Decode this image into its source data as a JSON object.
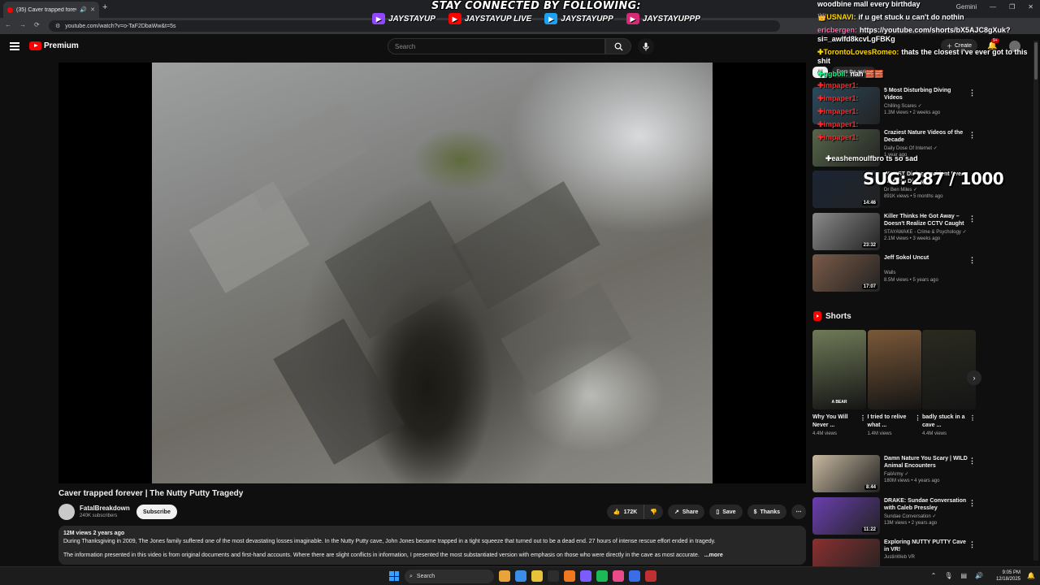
{
  "browser": {
    "tab_title": "(35) Caver trapped forever",
    "url": "youtube.com/watch?v=o-TaF2DbaWw&t=5s",
    "gemini_label": "Gemini"
  },
  "overlay": {
    "banner": "STAY CONNECTED BY FOLLOWING:",
    "socials": [
      {
        "platform_icon": "twitch-icon",
        "handle": "JAYSTAYUP",
        "color": "#9146ff"
      },
      {
        "platform_icon": "youtube-icon",
        "handle": "JAYSTAYUP LIVE",
        "color": "#ff0000"
      },
      {
        "platform_icon": "twitter-icon",
        "handle": "JAYSTAYUPP",
        "color": "#1da1f2"
      },
      {
        "platform_icon": "instagram-icon",
        "handle": "JAYSTAYUPPP",
        "color": "#d62976"
      }
    ],
    "chat": [
      {
        "user": "",
        "text": "woodbine mall every birthday",
        "color": "#ffffff"
      },
      {
        "user": "👑USNAVI:",
        "text": "if u get stuck u can't do nothin",
        "color": "#ffd700"
      },
      {
        "user": "ericbergen:",
        "text": "https://youtube.com/shorts/bX5AJC8gXuk?si=_awlfd8kcvLgFBKg",
        "color": "#ff69b4"
      },
      {
        "user": "✚TorontoLovesRomeo:",
        "text": "thats the closest i've ever got to this shit",
        "color": "#ffd700"
      },
      {
        "user": "✚ggboii:",
        "text": "nah 🧱🧱",
        "color": "#00ff7f"
      }
    ],
    "impaper_lines": [
      "✚impaper1:",
      "✚impaper1:",
      "✚impaper1:",
      "✚impaper1:",
      "✚impaper1:"
    ],
    "chat_extra": "✚eashemoulfbro ts so sad",
    "sub_goal": "SUG: 287 / 1000"
  },
  "header": {
    "logo_text": "Premium",
    "search_placeholder": "Search",
    "create_label": "Create",
    "notif_count": "9+"
  },
  "video": {
    "title": "Caver trapped forever | The Nutty Putty Tragedy",
    "channel": "FatalBreakdown",
    "subscribers": "240K subscribers",
    "subscribe_label": "Subscribe",
    "likes": "172K",
    "share_label": "Share",
    "save_label": "Save",
    "thanks_label": "Thanks",
    "views": "12M views",
    "age": "2 years ago",
    "description_1": "During Thanksgiving in 2009, The Jones family suffered one of the most devastating losses imaginable. In the Nutty Putty cave, John Jones became trapped in a tight squeeze that turned out to be a dead end. 27 hours of intense rescue effort ended in tragedy.",
    "description_2": "The information presented in this video is from original documents and first-hand accounts. Where there are slight conflicts in information, I presented the most substantiated version with emphasis on those who were directly in the cave as most accurate.",
    "more_label": "...more"
  },
  "sidebar": {
    "chips": [
      "All",
      "From the series"
    ],
    "recommendations": [
      {
        "title": "5 Most Disturbing Diving Videos",
        "channel": "Chilling Scares ✓",
        "meta": "1.3M views • 2 weeks ago",
        "duration": "",
        "bg": "#2b4a5c"
      },
      {
        "title": "Craziest Nature Videos of the Decade",
        "channel": "Daily Dose Of Internet ✓",
        "meta": "1 year ago",
        "duration": "",
        "bg": "#56664a"
      },
      {
        "title": "WORST Diving Accident Ever - Trapped Diving",
        "channel": "Dr Ben Miles ✓",
        "meta": "891K views • 5 months ago",
        "duration": "14:46",
        "bg": "#1b2535"
      },
      {
        "title": "Killer Thinks He Got Away – Doesn't Realize CCTV Caught ...",
        "channel": "STAYAWAKE - Crime & Psychology ✓",
        "meta": "2.1M views • 3 weeks ago",
        "duration": "23:32",
        "bg": "#8a8a8a"
      },
      {
        "title": "Jeff Sokol Uncut",
        "channel": "Walls",
        "meta": "8.5M views • 5 years ago",
        "duration": "17:07",
        "bg": "#7a5a48"
      }
    ],
    "shorts_heading": "Shorts",
    "shorts": [
      {
        "title": "Why You Will Never ...",
        "views": "4.4M views",
        "bg": "#6f7a58",
        "caption": "A BEAR"
      },
      {
        "title": "I tried to relive what ...",
        "views": "1.4M views",
        "bg": "#7a5838",
        "caption": ""
      },
      {
        "title": "badly stuck in a cave ...",
        "views": "4.4M views",
        "bg": "#2a2a20",
        "caption": ""
      }
    ],
    "more_recommendations": [
      {
        "title": "Damn Nature You Scary | WILD Animal Encounters",
        "channel": "FailArmy ✓",
        "meta": "180M views • 4 years ago",
        "duration": "8:44",
        "bg": "#c8b9a0"
      },
      {
        "title": "DRAKE: Sundae Conversation with Caleb Pressley",
        "channel": "Sundae Conversation ✓",
        "meta": "13M views • 2 years ago",
        "duration": "11:22",
        "bg": "#6a3fb0"
      },
      {
        "title": "Exploring NUTTY PUTTY Cave in VR!",
        "channel": "JustinWeb VR",
        "meta": "",
        "duration": "",
        "bg": "#8a3030"
      }
    ]
  },
  "taskbar": {
    "search_placeholder": "Search",
    "time": "9:05 PM",
    "date": "12/18/2025",
    "apps": [
      "#e8a43a",
      "#3a8ee8",
      "#e8c23a",
      "#2d2d2d",
      "#f07820",
      "#7b5cff",
      "#1db954",
      "#e84a8a",
      "#3a6ee8",
      "#c03030"
    ]
  }
}
